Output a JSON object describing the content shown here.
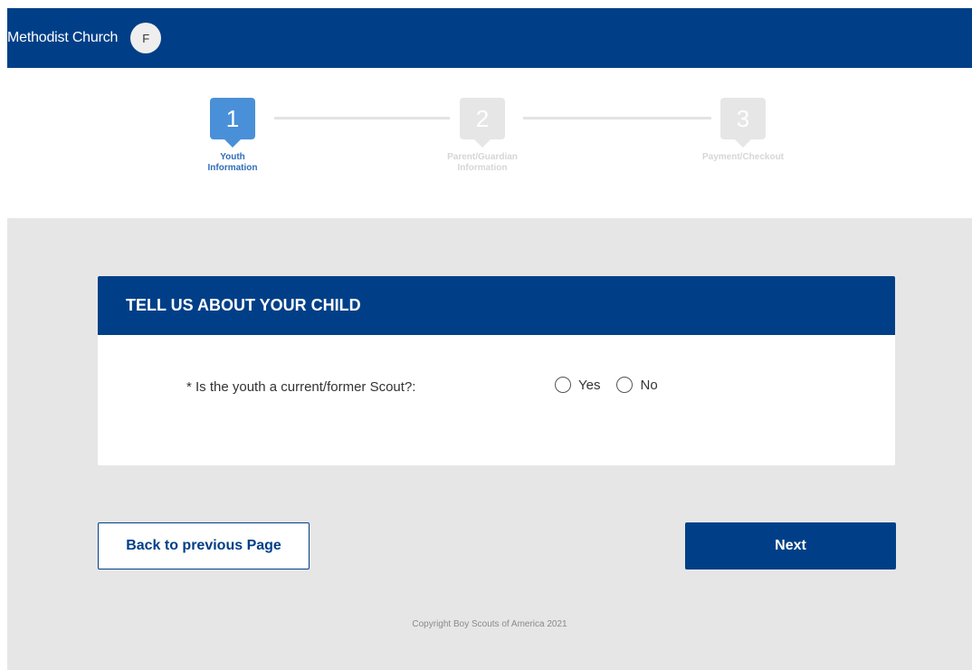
{
  "header": {
    "brand": "Methodist Church",
    "avatar_initial": "F"
  },
  "stepper": {
    "steps": [
      {
        "number": "1",
        "label_line1": "Youth",
        "label_line2": "Information",
        "state": "active"
      },
      {
        "number": "2",
        "label_line1": "Parent/Guardian",
        "label_line2": "Information",
        "state": "inactive"
      },
      {
        "number": "3",
        "label_line1": "Payment/Checkout",
        "label_line2": "",
        "state": "inactive"
      }
    ]
  },
  "card": {
    "title": "TELL US ABOUT YOUR CHILD",
    "question": "* Is the youth a current/former Scout?:",
    "options": [
      "Yes",
      "No"
    ]
  },
  "buttons": {
    "back": "Back to previous Page",
    "next": "Next"
  },
  "footer": {
    "copyright": "Copyright Boy Scouts of America 2021"
  },
  "colors": {
    "brand_blue": "#003f87",
    "step_active": "#4a90d9",
    "background": "#e6e6e6"
  }
}
